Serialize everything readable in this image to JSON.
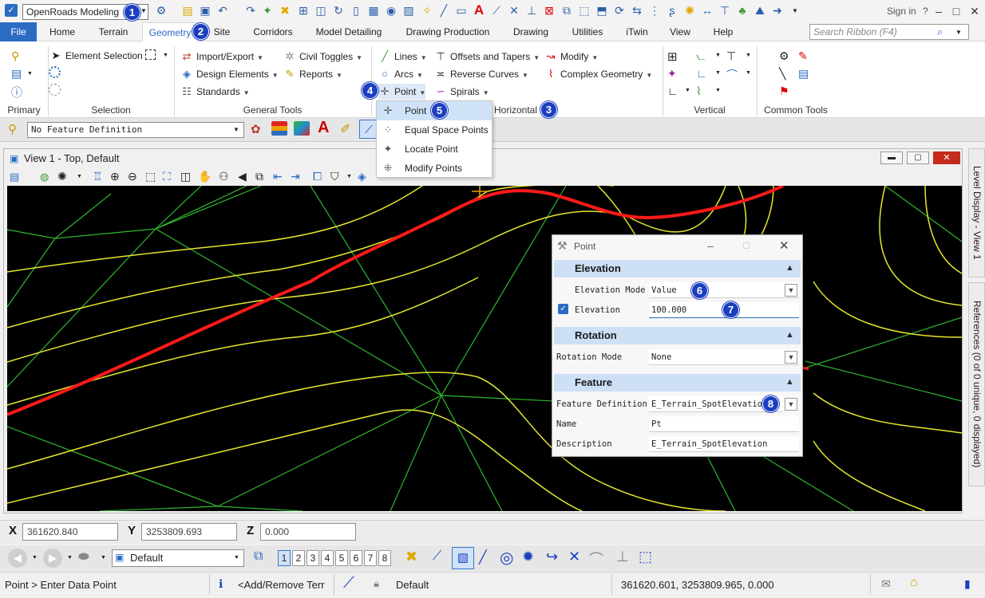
{
  "titlebar": {
    "workspace": "OpenRoads Modeling",
    "sign_in": "Sign in",
    "help": "?"
  },
  "tabs": {
    "items": [
      "File",
      "Home",
      "Terrain",
      "Geometry",
      "Site",
      "Corridors",
      "Model Detailing",
      "Drawing Production",
      "Drawing",
      "Utilities",
      "iTwin",
      "View",
      "Help"
    ],
    "active": "Geometry",
    "search_placeholder": "Search Ribbon (F4)"
  },
  "ribbon": {
    "selection": {
      "element_selection": "Element Selection"
    },
    "general_tools": {
      "import_export": "Import/Export",
      "design_elements": "Design Elements",
      "standards": "Standards",
      "civil_toggles": "Civil Toggles",
      "reports": "Reports"
    },
    "horizontal": {
      "lines": "Lines",
      "arcs": "Arcs",
      "point": "Point",
      "offsets_tapers": "Offsets and Tapers",
      "reverse_curves": "Reverse Curves",
      "spirals": "Spirals",
      "modify": "Modify",
      "complex_geometry": "Complex Geometry"
    },
    "groups": {
      "primary": "Primary",
      "selection": "Selection",
      "general_tools": "General Tools",
      "horizontal": "Horizontal",
      "vertical": "Vertical",
      "common_tools": "Common Tools"
    }
  },
  "feature_bar": {
    "definition": "No Feature Definition"
  },
  "point_menu": {
    "items": [
      "Point",
      "Equal Space Points",
      "Locate Point",
      "Modify Points"
    ],
    "highlighted": "Point"
  },
  "view": {
    "title": "View 1 - Top, Default"
  },
  "side_panels": {
    "level_display": "Level Display - View 1",
    "references": "References (0 of 0 unique, 0 displayed)"
  },
  "dialog": {
    "title": "Point",
    "elevation_section": "Elevation",
    "elevation_mode_label": "Elevation Mode",
    "elevation_mode_value": "Value",
    "elevation_label": "Elevation",
    "elevation_value": "100.000",
    "elevation_checked": true,
    "rotation_section": "Rotation",
    "rotation_mode_label": "Rotation Mode",
    "rotation_mode_value": "None",
    "feature_section": "Feature",
    "feature_definition_label": "Feature Definition",
    "feature_definition_value": "E_Terrain_SpotElevation",
    "name_label": "Name",
    "name_value": "Pt",
    "description_label": "Description",
    "description_value": "E_Terrain_SpotElevation"
  },
  "callouts": [
    "1",
    "2",
    "3",
    "4",
    "5",
    "6",
    "7",
    "8"
  ],
  "coordinates": {
    "x_label": "X",
    "x_value": "361620.840",
    "y_label": "Y",
    "y_value": "3253809.693",
    "z_label": "Z",
    "z_value": "0.000"
  },
  "bottom_toolbar": {
    "view_group": "Default",
    "view_numbers": [
      "1",
      "2",
      "3",
      "4",
      "5",
      "6",
      "7",
      "8"
    ]
  },
  "statusbar": {
    "prompt": "Point > Enter Data Point",
    "message": "<Add/Remove Terr",
    "active_level": "Default",
    "cursor_coords": "361620.601, 3253809.965, 0.000"
  },
  "colors": {
    "accent": "#2b6bc4",
    "badge": "#1b3fbf",
    "canvas_bg": "#000000",
    "contour": "#e6e62c",
    "triangle": "#2eb82e",
    "alignment": "#ff1a1a"
  }
}
